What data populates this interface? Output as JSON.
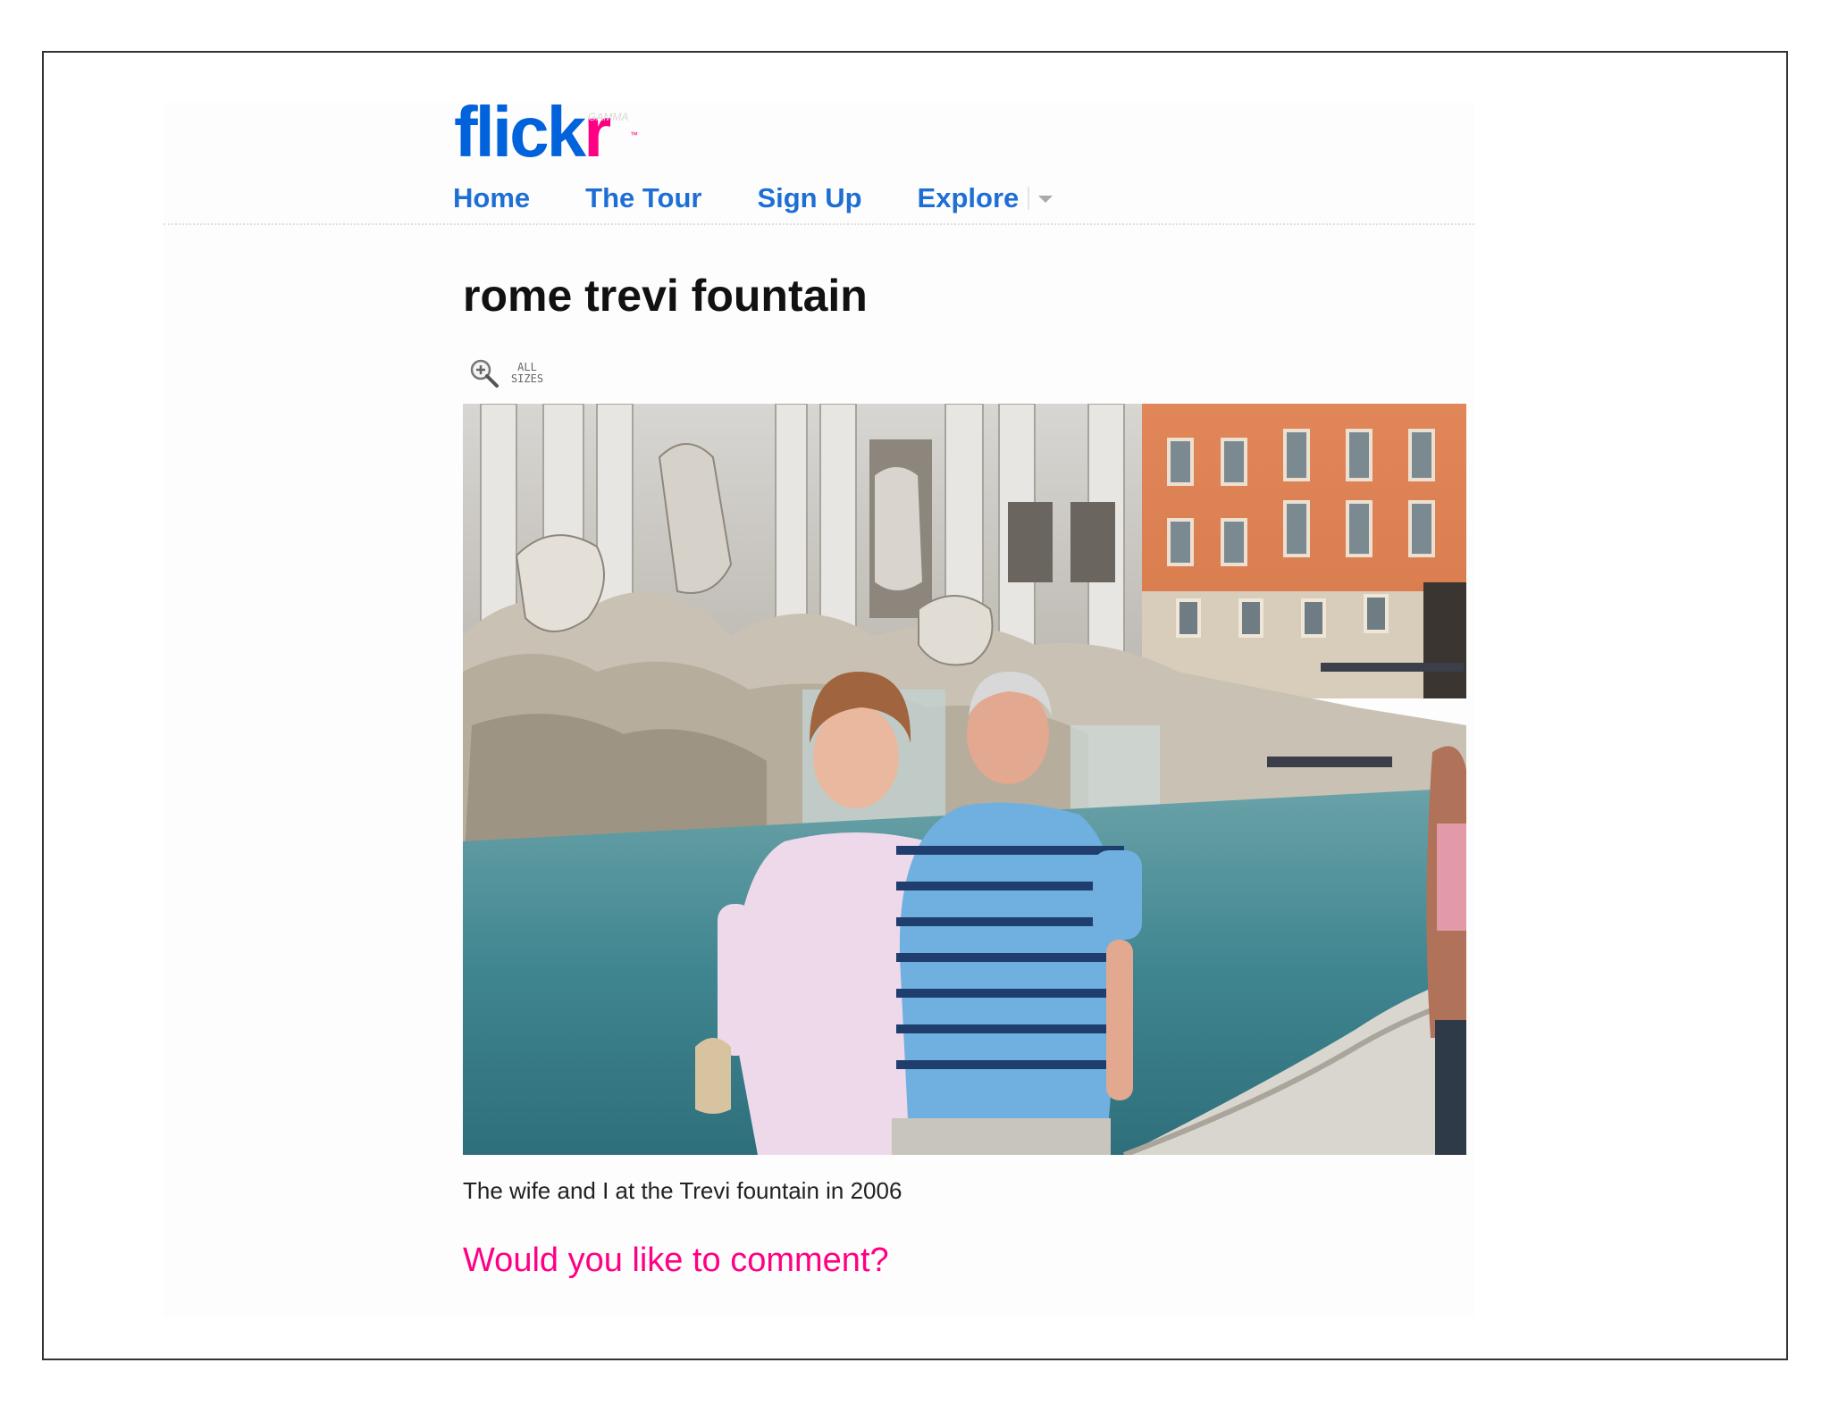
{
  "brand": {
    "logo_blue": "flick",
    "logo_pink": "r",
    "logo_superscript": "GAMMA",
    "logo_tm": "™",
    "colors": {
      "blue": "#0063dc",
      "pink": "#ff0084"
    }
  },
  "nav": {
    "items": [
      {
        "label": "Home"
      },
      {
        "label": "The Tour"
      },
      {
        "label": "Sign Up"
      },
      {
        "label": "Explore"
      }
    ],
    "explore_dropdown_icon": "caret-down-icon"
  },
  "photo_page": {
    "title": "rome trevi fountain",
    "all_sizes": {
      "line1": "ALL",
      "line2": "SIZES",
      "icon": "magnifier-plus-icon"
    },
    "photo_alt": "Couple standing in front of the Trevi Fountain",
    "caption": "The wife and I at the Trevi fountain in 2006",
    "comment_prompt": "Would you like to comment?"
  }
}
